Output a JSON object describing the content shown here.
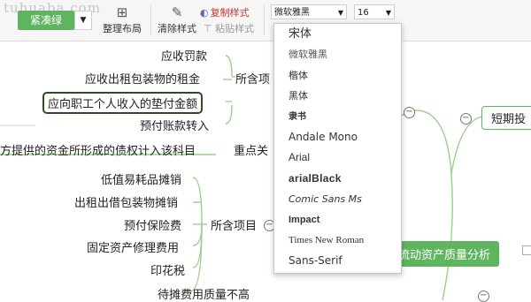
{
  "watermark": "tuhuaba.com",
  "toolbar": {
    "theme_button": "紧凑绿",
    "arrange_layout": "整理布局",
    "clear_style": "清除样式",
    "copy_style": "复制样式",
    "paste_style": "粘贴样式",
    "font_value": "微软雅黑",
    "size_value": "16"
  },
  "font_options": [
    "宋体",
    "微软雅黑",
    "楷体",
    "黑体",
    "隶书",
    "Andale Mono",
    "Arial",
    "arialBlack",
    "Comic Sans Ms",
    "Impact",
    "Times New Roman",
    "Sans-Serif"
  ],
  "mindmap": {
    "nodes_top": [
      "应收罚款",
      "应收出租包装物的租金",
      "应向职工个人收入的垫付金额",
      "预付账款转入"
    ],
    "branch_contains_1": "所含项",
    "bottom_text": "方提供的资金所形成的债权计入该科目",
    "key_points": "重点关",
    "nodes_mid": [
      "低值易耗品摊销",
      "出租出借包装物摊销",
      "预付保险费",
      "固定资产修理费用",
      "印花税",
      "待摊费用质量不高"
    ],
    "branch_contains_2": "所含项目",
    "short_term": "短期投",
    "current_assets": "流动资产质量分析"
  },
  "colors": {
    "accent_green": "#5fb55f",
    "copy_red": "#cc3333",
    "line_green": "#9ccf8c"
  }
}
